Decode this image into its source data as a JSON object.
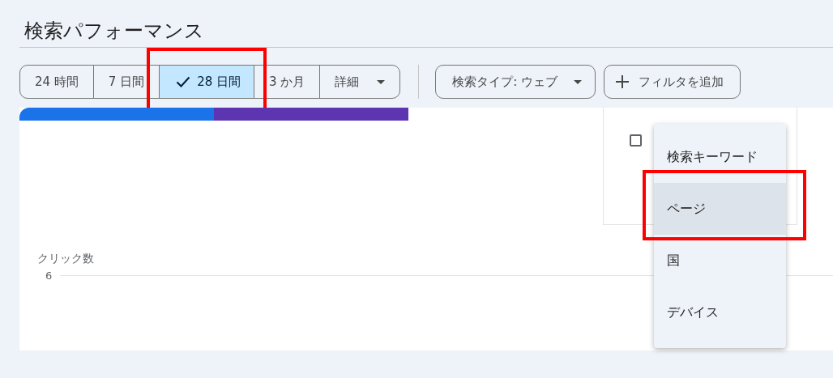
{
  "title": "検索パフォーマンス",
  "date_ranges": [
    {
      "label": "24 時間",
      "selected": false,
      "annotated": false
    },
    {
      "label": "7 日間",
      "selected": false,
      "annotated": false
    },
    {
      "label": "28 日間",
      "selected": true,
      "annotated": true
    },
    {
      "label": "3 か月",
      "selected": false,
      "annotated": false
    },
    {
      "label": "詳細",
      "selected": false,
      "annotated": false,
      "dropdown": true
    }
  ],
  "search_type_chip": {
    "label": "検索タイプ: ウェブ"
  },
  "add_filter_chip": {
    "label": "フィルタを追加"
  },
  "filter_menu": [
    {
      "label": "検索キーワード",
      "selected": false,
      "annotated": false
    },
    {
      "label": "ページ",
      "selected": true,
      "annotated": true
    },
    {
      "label": "国",
      "selected": false,
      "annotated": false
    },
    {
      "label": "デバイス",
      "selected": false,
      "annotated": false
    }
  ],
  "metric_tiles": [
    {
      "kind": "filled",
      "color": "#1a73e8"
    },
    {
      "kind": "filled",
      "color": "#5e35b1"
    },
    {
      "kind": "blank"
    },
    {
      "kind": "checkbox",
      "checked": false
    }
  ],
  "chart": {
    "axis_label": "クリック数",
    "ticks": [
      "6"
    ]
  }
}
